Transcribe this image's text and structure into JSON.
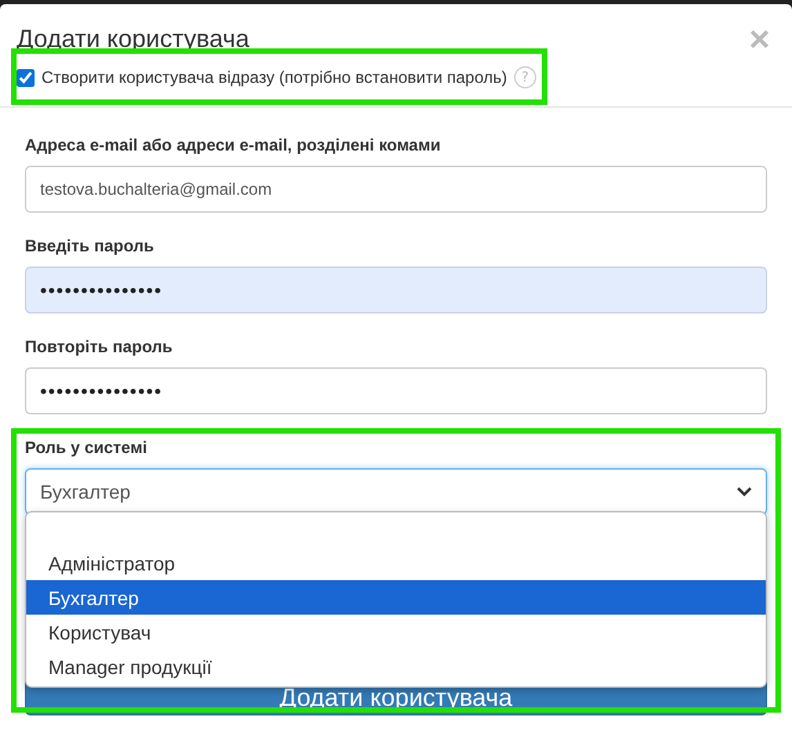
{
  "dialog": {
    "title": "Додати користувача",
    "close": "×",
    "create_now": {
      "label": "Створити користувача відразу (потрібно встановити пароль)",
      "checked": true,
      "help": "?"
    }
  },
  "fields": [
    {
      "label": "Адреса e-mail або адреси e-mail, розділені комами",
      "value": "testova.buchalteria@gmail.com",
      "kind": "text",
      "autofilled": false
    },
    {
      "label": "Введіть пароль",
      "value": "•••••••••••••••",
      "kind": "password",
      "autofilled": true
    },
    {
      "label": "Повторіть пароль",
      "value": "•••••••••••••••",
      "kind": "password",
      "autofilled": false
    }
  ],
  "role": {
    "label": "Роль у системі",
    "value": "Бухгалтер",
    "expanded": true,
    "options": [
      {
        "label": "Адміністратор",
        "selected": false
      },
      {
        "label": "Бухгалтер",
        "selected": true
      },
      {
        "label": "Користувач",
        "selected": false
      },
      {
        "label": "Manager продукції",
        "selected": false
      }
    ]
  },
  "submit": {
    "label": "Додати користувача"
  }
}
